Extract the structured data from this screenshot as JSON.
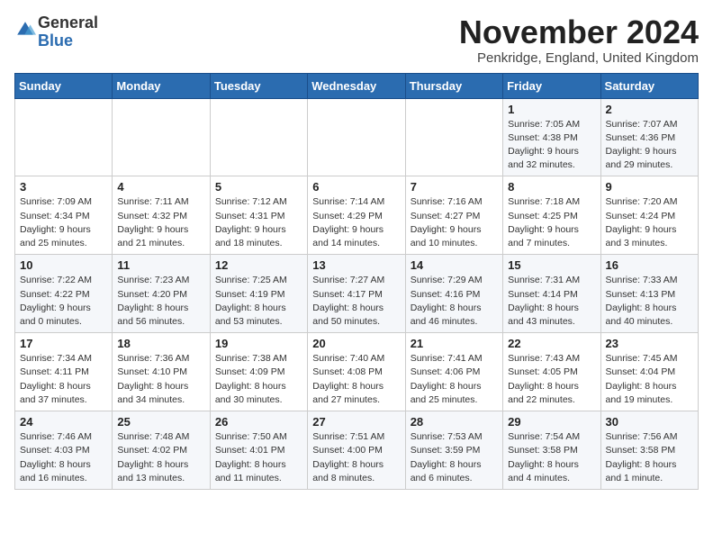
{
  "header": {
    "logo_general": "General",
    "logo_blue": "Blue",
    "month_title": "November 2024",
    "location": "Penkridge, England, United Kingdom"
  },
  "weekdays": [
    "Sunday",
    "Monday",
    "Tuesday",
    "Wednesday",
    "Thursday",
    "Friday",
    "Saturday"
  ],
  "weeks": [
    [
      {
        "day": "",
        "info": ""
      },
      {
        "day": "",
        "info": ""
      },
      {
        "day": "",
        "info": ""
      },
      {
        "day": "",
        "info": ""
      },
      {
        "day": "",
        "info": ""
      },
      {
        "day": "1",
        "info": "Sunrise: 7:05 AM\nSunset: 4:38 PM\nDaylight: 9 hours\nand 32 minutes."
      },
      {
        "day": "2",
        "info": "Sunrise: 7:07 AM\nSunset: 4:36 PM\nDaylight: 9 hours\nand 29 minutes."
      }
    ],
    [
      {
        "day": "3",
        "info": "Sunrise: 7:09 AM\nSunset: 4:34 PM\nDaylight: 9 hours\nand 25 minutes."
      },
      {
        "day": "4",
        "info": "Sunrise: 7:11 AM\nSunset: 4:32 PM\nDaylight: 9 hours\nand 21 minutes."
      },
      {
        "day": "5",
        "info": "Sunrise: 7:12 AM\nSunset: 4:31 PM\nDaylight: 9 hours\nand 18 minutes."
      },
      {
        "day": "6",
        "info": "Sunrise: 7:14 AM\nSunset: 4:29 PM\nDaylight: 9 hours\nand 14 minutes."
      },
      {
        "day": "7",
        "info": "Sunrise: 7:16 AM\nSunset: 4:27 PM\nDaylight: 9 hours\nand 10 minutes."
      },
      {
        "day": "8",
        "info": "Sunrise: 7:18 AM\nSunset: 4:25 PM\nDaylight: 9 hours\nand 7 minutes."
      },
      {
        "day": "9",
        "info": "Sunrise: 7:20 AM\nSunset: 4:24 PM\nDaylight: 9 hours\nand 3 minutes."
      }
    ],
    [
      {
        "day": "10",
        "info": "Sunrise: 7:22 AM\nSunset: 4:22 PM\nDaylight: 9 hours\nand 0 minutes."
      },
      {
        "day": "11",
        "info": "Sunrise: 7:23 AM\nSunset: 4:20 PM\nDaylight: 8 hours\nand 56 minutes."
      },
      {
        "day": "12",
        "info": "Sunrise: 7:25 AM\nSunset: 4:19 PM\nDaylight: 8 hours\nand 53 minutes."
      },
      {
        "day": "13",
        "info": "Sunrise: 7:27 AM\nSunset: 4:17 PM\nDaylight: 8 hours\nand 50 minutes."
      },
      {
        "day": "14",
        "info": "Sunrise: 7:29 AM\nSunset: 4:16 PM\nDaylight: 8 hours\nand 46 minutes."
      },
      {
        "day": "15",
        "info": "Sunrise: 7:31 AM\nSunset: 4:14 PM\nDaylight: 8 hours\nand 43 minutes."
      },
      {
        "day": "16",
        "info": "Sunrise: 7:33 AM\nSunset: 4:13 PM\nDaylight: 8 hours\nand 40 minutes."
      }
    ],
    [
      {
        "day": "17",
        "info": "Sunrise: 7:34 AM\nSunset: 4:11 PM\nDaylight: 8 hours\nand 37 minutes."
      },
      {
        "day": "18",
        "info": "Sunrise: 7:36 AM\nSunset: 4:10 PM\nDaylight: 8 hours\nand 34 minutes."
      },
      {
        "day": "19",
        "info": "Sunrise: 7:38 AM\nSunset: 4:09 PM\nDaylight: 8 hours\nand 30 minutes."
      },
      {
        "day": "20",
        "info": "Sunrise: 7:40 AM\nSunset: 4:08 PM\nDaylight: 8 hours\nand 27 minutes."
      },
      {
        "day": "21",
        "info": "Sunrise: 7:41 AM\nSunset: 4:06 PM\nDaylight: 8 hours\nand 25 minutes."
      },
      {
        "day": "22",
        "info": "Sunrise: 7:43 AM\nSunset: 4:05 PM\nDaylight: 8 hours\nand 22 minutes."
      },
      {
        "day": "23",
        "info": "Sunrise: 7:45 AM\nSunset: 4:04 PM\nDaylight: 8 hours\nand 19 minutes."
      }
    ],
    [
      {
        "day": "24",
        "info": "Sunrise: 7:46 AM\nSunset: 4:03 PM\nDaylight: 8 hours\nand 16 minutes."
      },
      {
        "day": "25",
        "info": "Sunrise: 7:48 AM\nSunset: 4:02 PM\nDaylight: 8 hours\nand 13 minutes."
      },
      {
        "day": "26",
        "info": "Sunrise: 7:50 AM\nSunset: 4:01 PM\nDaylight: 8 hours\nand 11 minutes."
      },
      {
        "day": "27",
        "info": "Sunrise: 7:51 AM\nSunset: 4:00 PM\nDaylight: 8 hours\nand 8 minutes."
      },
      {
        "day": "28",
        "info": "Sunrise: 7:53 AM\nSunset: 3:59 PM\nDaylight: 8 hours\nand 6 minutes."
      },
      {
        "day": "29",
        "info": "Sunrise: 7:54 AM\nSunset: 3:58 PM\nDaylight: 8 hours\nand 4 minutes."
      },
      {
        "day": "30",
        "info": "Sunrise: 7:56 AM\nSunset: 3:58 PM\nDaylight: 8 hours\nand 1 minute."
      }
    ]
  ]
}
